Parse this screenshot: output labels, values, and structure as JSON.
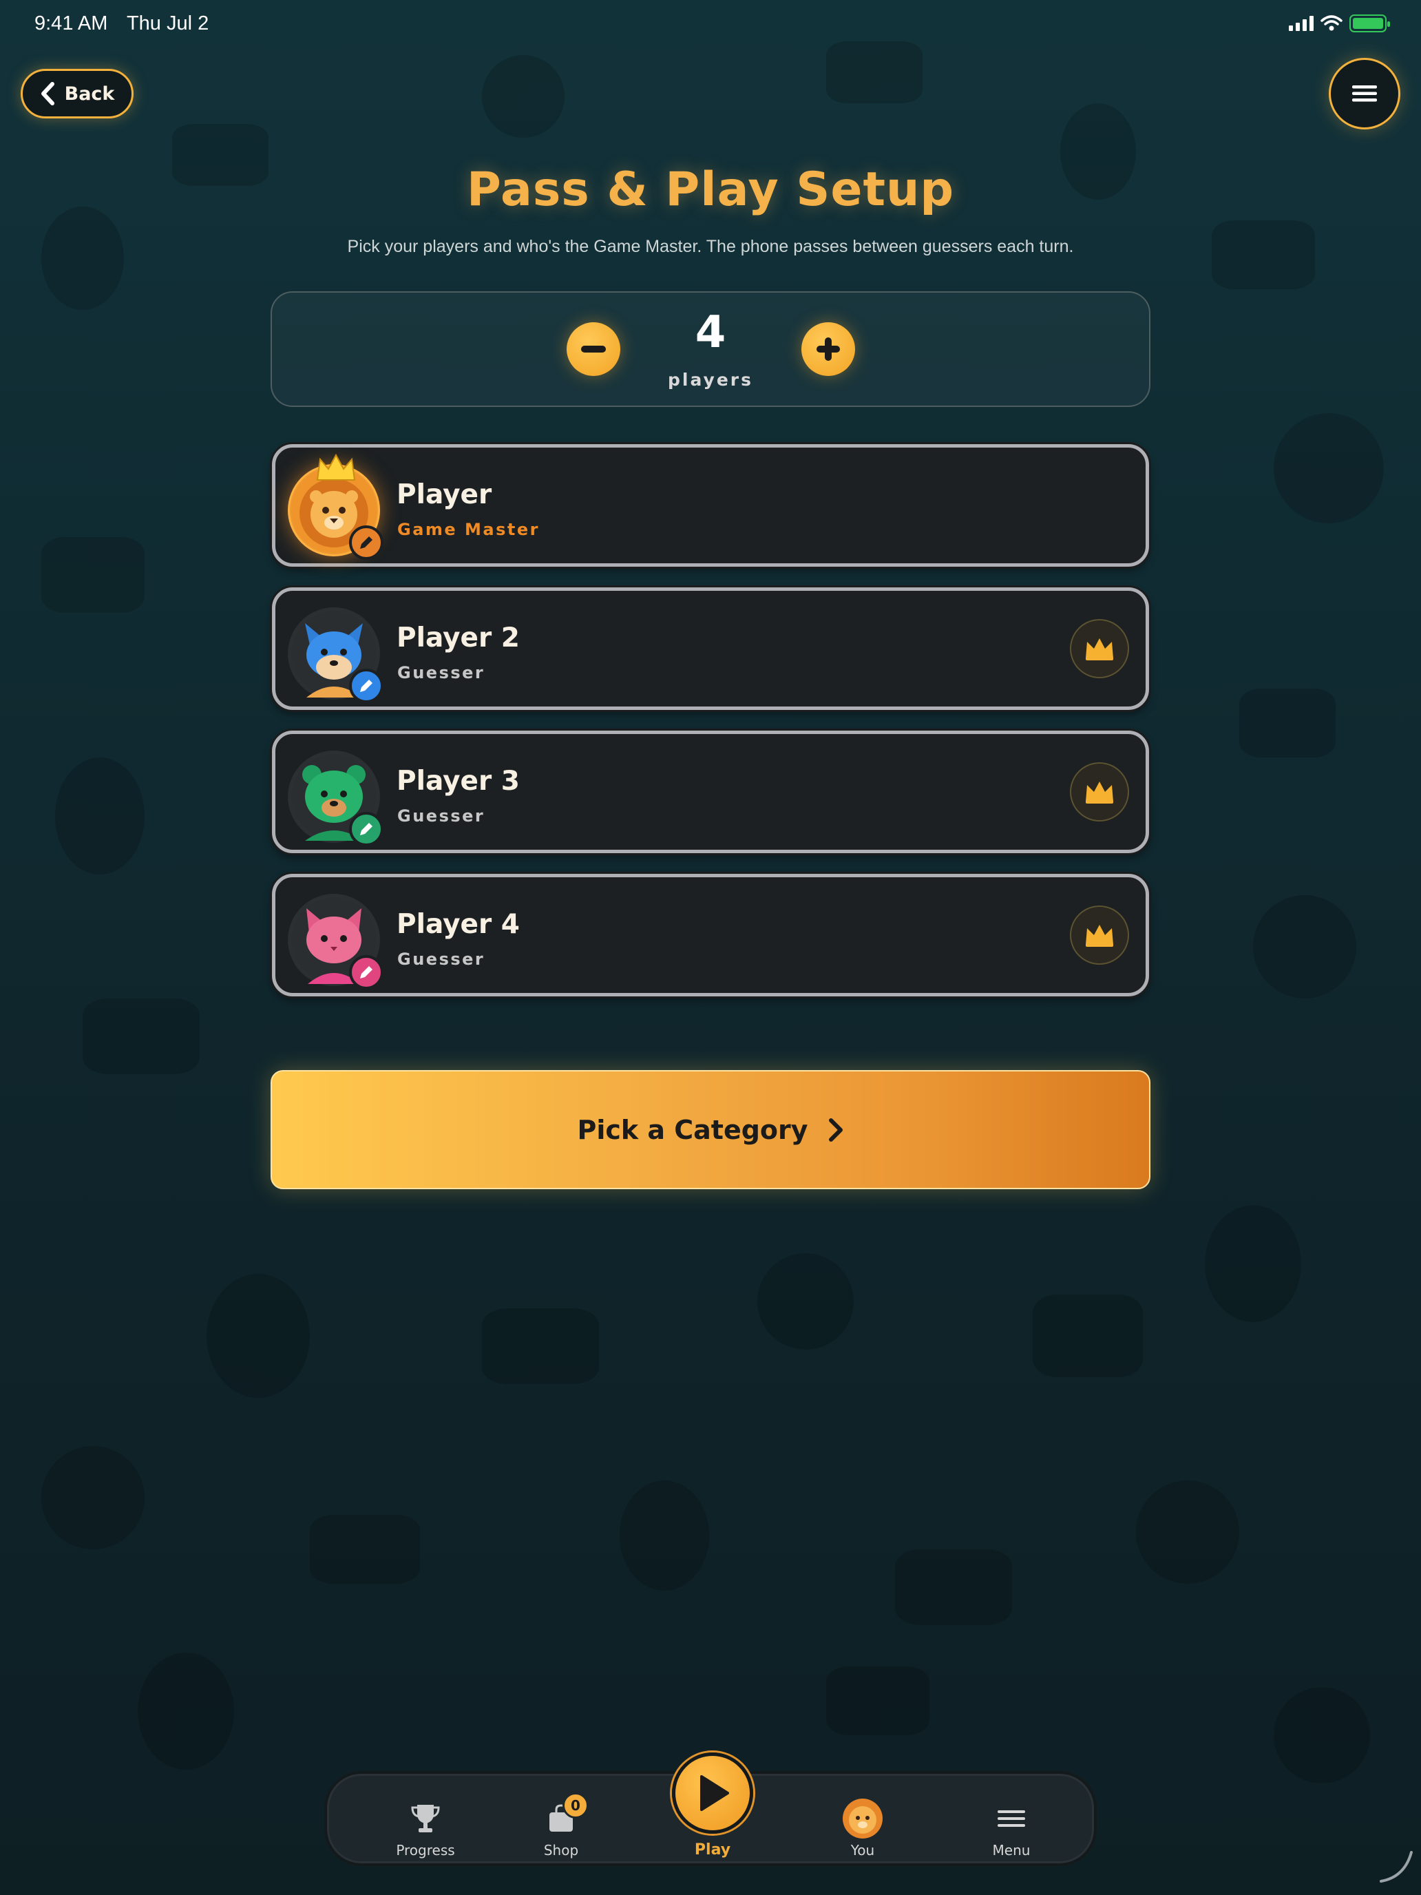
{
  "status": {
    "time": "9:41 AM",
    "date": "Thu Jul 2"
  },
  "nav": {
    "back_label": "Back"
  },
  "header": {
    "title": "Pass & Play Setup",
    "subtitle": "Pick your players and who's the Game Master. The phone passes between guessers each turn."
  },
  "counter": {
    "value": "4",
    "label": "players"
  },
  "players": [
    {
      "name": "Player",
      "role": "Game Master",
      "avatar": "lion",
      "badge_color": "#e8822a",
      "is_game_master": true
    },
    {
      "name": "Player 2",
      "role": "Guesser",
      "avatar": "fox",
      "badge_color": "#2f86e6",
      "is_game_master": false
    },
    {
      "name": "Player 3",
      "role": "Guesser",
      "avatar": "bear",
      "badge_color": "#25a36a",
      "is_game_master": false
    },
    {
      "name": "Player 4",
      "role": "Guesser",
      "avatar": "cat",
      "badge_color": "#e0457f",
      "is_game_master": false
    }
  ],
  "cta": {
    "label": "Pick a Category"
  },
  "tabs": [
    {
      "label": "Progress",
      "icon": "trophy-icon"
    },
    {
      "label": "Shop",
      "icon": "bag-icon",
      "badge": "0"
    },
    {
      "label": "Play",
      "icon": "play-icon",
      "active": true
    },
    {
      "label": "You",
      "icon": "lion-avatar-icon"
    },
    {
      "label": "Menu",
      "icon": "menu-icon"
    }
  ],
  "colors": {
    "accent": "#f4ad3a",
    "background": "#12323a",
    "card": "#1c2022"
  }
}
